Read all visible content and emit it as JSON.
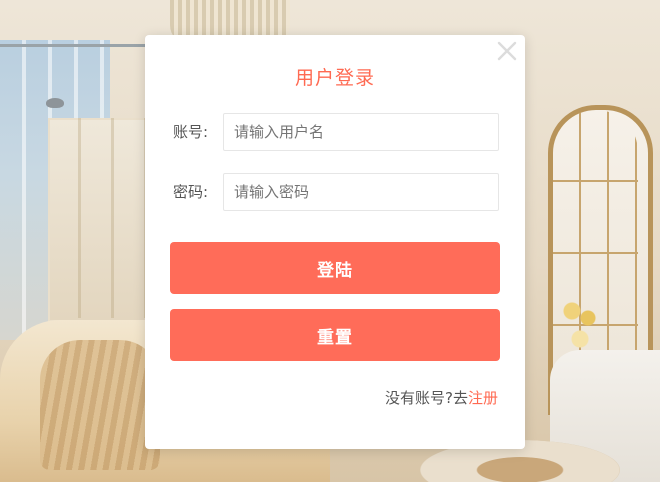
{
  "modal": {
    "title": "用户登录",
    "close_icon": "close-icon",
    "username": {
      "label": "账号:",
      "placeholder": "请输入用户名",
      "value": ""
    },
    "password": {
      "label": "密码:",
      "placeholder": "请输入密码",
      "value": ""
    },
    "login_label": "登陆",
    "reset_label": "重置",
    "footer": {
      "prompt": "没有账号?去",
      "register_link": "注册"
    }
  },
  "colors": {
    "accent": "#ff6a52",
    "button": "#ff6c59",
    "text": "#555555",
    "close_icon": "#dddddd"
  }
}
